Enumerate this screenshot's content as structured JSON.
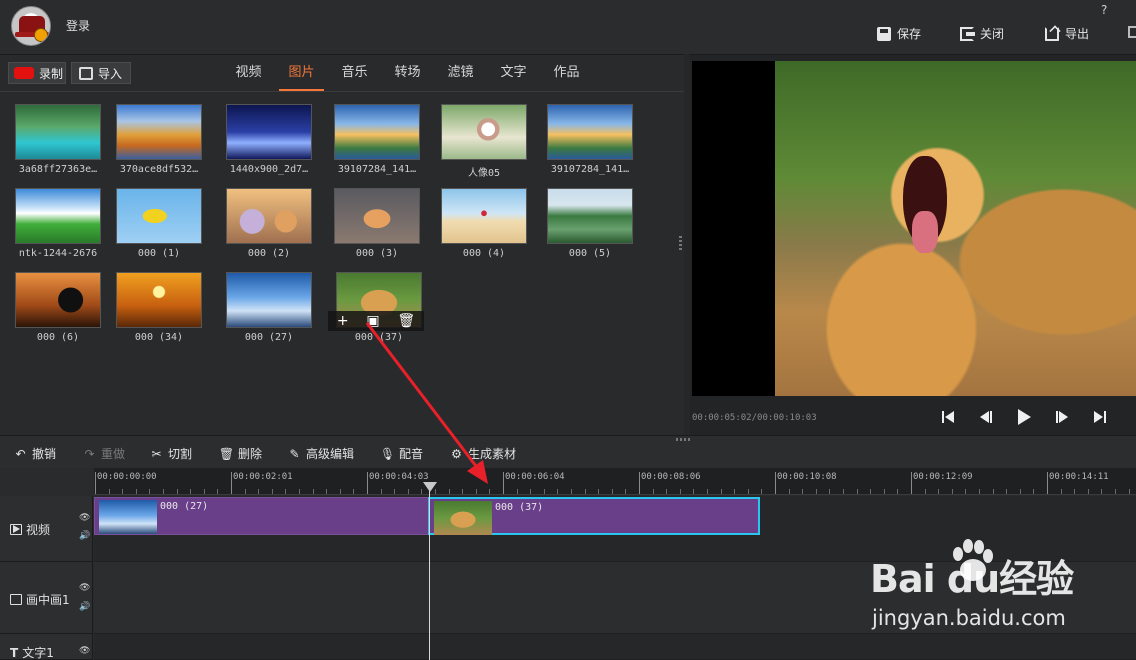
{
  "titlebar": {
    "login_label": "登录",
    "help_label": "?",
    "save_label": "保存",
    "close_label": "关闭",
    "export_label": "导出"
  },
  "media": {
    "record_label": "录制",
    "import_label": "导入",
    "tabs": [
      "视频",
      "图片",
      "音乐",
      "转场",
      "滤镜",
      "文字",
      "作品"
    ],
    "active_tab": "图片",
    "items": [
      {
        "caption": "3a68ff27363e…",
        "fill": "g-lake"
      },
      {
        "caption": "370ace8df532…",
        "fill": "g-autumn"
      },
      {
        "caption": "1440x900_2d7…",
        "fill": "g-night"
      },
      {
        "caption": "39107284_141…",
        "fill": "g-sunset"
      },
      {
        "caption": "人像05",
        "fill": "g-girl"
      },
      {
        "caption": "39107284_141…",
        "fill": "g-sunset"
      },
      {
        "caption": "ntk-1244-2676",
        "fill": "g-island"
      },
      {
        "caption": "000 (1)",
        "fill": "g-bird"
      },
      {
        "caption": "000 (2)",
        "fill": "g-zoo"
      },
      {
        "caption": "000 (3)",
        "fill": "g-judy"
      },
      {
        "caption": "000 (4)",
        "fill": "g-beach"
      },
      {
        "caption": "000 (5)",
        "fill": "g-river"
      },
      {
        "caption": "000 (6)",
        "fill": "g-silhouette"
      },
      {
        "caption": "000 (34)",
        "fill": "g-dance"
      },
      {
        "caption": "000 (27)",
        "fill": "g-sky"
      },
      {
        "caption": "000 (37)",
        "fill": "g-lion"
      }
    ],
    "hover_actions": [
      "+",
      "▣",
      "🗑"
    ]
  },
  "preview": {
    "timecode": "00:00:05:02/00:00:10:03",
    "controls": [
      "skip-start",
      "prev-frame",
      "play",
      "next-frame",
      "skip-end"
    ]
  },
  "toolbar": {
    "undo": "撤销",
    "redo": "重做",
    "cut": "切割",
    "delete": "删除",
    "advanced": "高级编辑",
    "dub": "配音",
    "generate": "生成素材"
  },
  "timeline": {
    "ruler_labels": [
      "00:00:00:00",
      "00:00:02:01",
      "00:00:04:03",
      "00:00:06:04",
      "00:00:08:06",
      "00:00:10:08",
      "00:00:12:09",
      "00:00:14:11"
    ],
    "tracks": [
      {
        "name": "视频"
      },
      {
        "name": "画中画1"
      },
      {
        "name": "文字1"
      }
    ],
    "clips": [
      {
        "label": "000 (27)",
        "fill": "g-sky",
        "selected": false
      },
      {
        "label": "000 (37)",
        "fill": "g-lion",
        "selected": true
      }
    ]
  },
  "watermark": {
    "text": "Bai du经验",
    "url": "jingyan.baidu.com"
  },
  "colors": {
    "accent": "#f5783a",
    "clip": "#6a3f8a",
    "selection": "#29c6f0",
    "arrow": "#e8202a"
  }
}
